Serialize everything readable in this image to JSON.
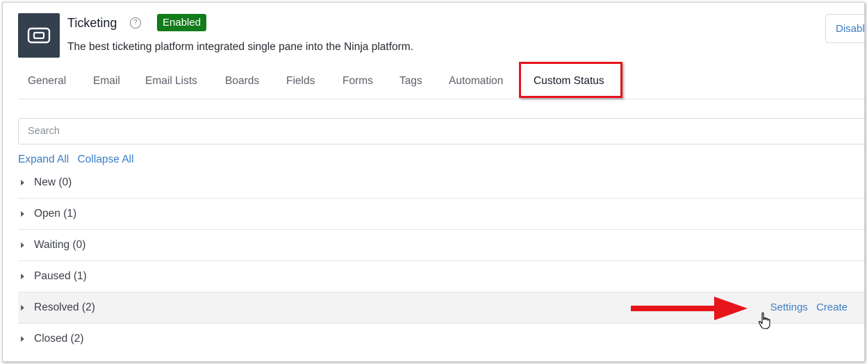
{
  "header": {
    "title": "Ticketing",
    "help_icon": "help-circle-icon",
    "help_glyph": "?",
    "badge": "Enabled",
    "badge_color": "#127b1a",
    "subtitle": "The best ticketing platform integrated single pane into the Ninja platform.",
    "disable_button": "Disable",
    "app_icon": "ticket-icon"
  },
  "tabs": [
    {
      "label": "General"
    },
    {
      "label": "Email"
    },
    {
      "label": "Email Lists"
    },
    {
      "label": "Boards"
    },
    {
      "label": "Fields"
    },
    {
      "label": "Forms"
    },
    {
      "label": "Tags"
    },
    {
      "label": "Automation"
    },
    {
      "label": "Custom Status",
      "active": true
    }
  ],
  "search": {
    "placeholder": "Search",
    "value": ""
  },
  "links": {
    "expand_all": "Expand All",
    "collapse_all": "Collapse All"
  },
  "statuses": [
    {
      "label": "New (0)"
    },
    {
      "label": "Open (1)"
    },
    {
      "label": "Waiting (0)"
    },
    {
      "label": "Paused (1)"
    },
    {
      "label": "Resolved (2)",
      "hovered": true
    },
    {
      "label": "Closed (2)"
    }
  ],
  "row_actions": {
    "settings": "Settings",
    "create": "Create"
  },
  "annotations": {
    "highlight_color": "#e8141b",
    "arrow_color": "#e8141b"
  },
  "colors": {
    "link": "#3a7dc4",
    "app_icon_bg": "#34404e"
  }
}
